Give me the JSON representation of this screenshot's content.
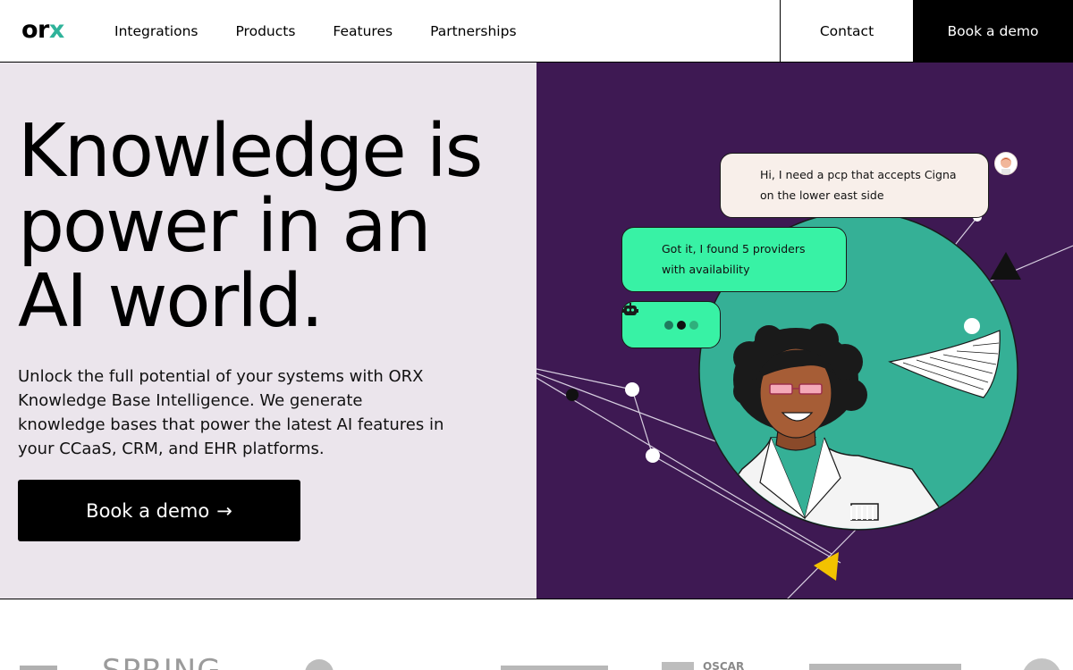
{
  "nav": {
    "logo_main": "or",
    "logo_accent": "x",
    "links": [
      "Integrations",
      "Products",
      "Features",
      "Partnerships"
    ],
    "contact_label": "Contact",
    "book_label": "Book a demo"
  },
  "hero": {
    "headline_lines": [
      "Knowledge is",
      "power in an",
      "AI world."
    ],
    "subtext": "Unlock the full potential of your systems with ORX Knowledge Base Intelligence. We generate knowledge bases that power the latest AI features in your CCaaS, CRM, and EHR platforms.",
    "cta_label": "Book a demo",
    "cta_arrow": "→"
  },
  "chat": {
    "user_message_lines": [
      "Hi, I need a pcp that accepts Cigna",
      "on the lower east side"
    ],
    "bot_message_lines": [
      "Got it, I found 5 providers",
      "with availability"
    ]
  },
  "logos": [
    "SPRING",
    "OSCAR"
  ],
  "colors": {
    "brand_accent": "#2fb39a",
    "hero_left_bg": "#ebe5ec",
    "hero_right_bg": "#3e1953",
    "circle_teal": "#35b096",
    "bot_bubble": "#38f2a5",
    "user_bubble": "#f8efea",
    "triangle_yellow": "#f2c200"
  }
}
